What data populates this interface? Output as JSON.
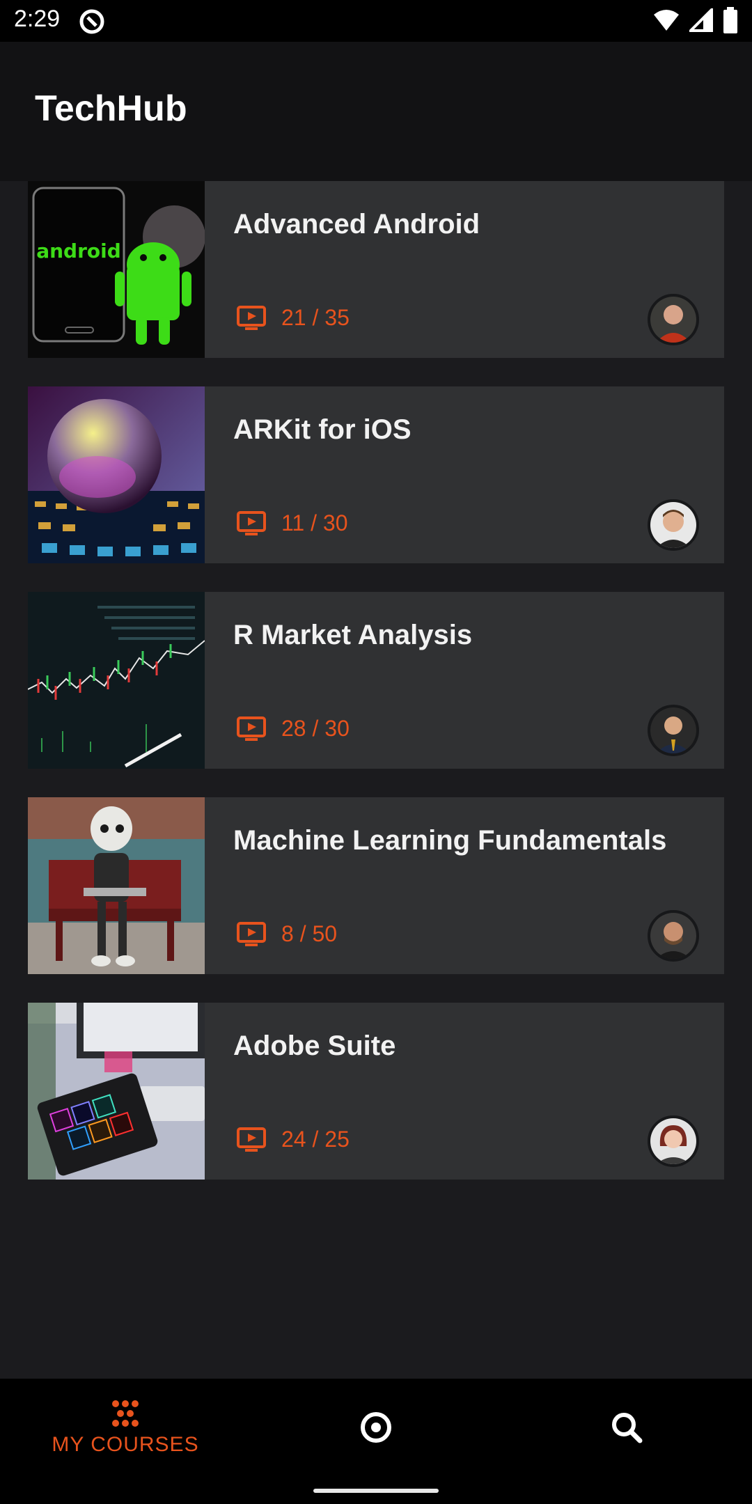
{
  "status_bar": {
    "time": "2:29",
    "icons": [
      "app-notification-icon",
      "wifi-icon",
      "signal-icon",
      "battery-icon"
    ]
  },
  "app_bar": {
    "title": "TechHub"
  },
  "colors": {
    "accent": "#e8531d",
    "card": "#303133",
    "background": "#1b1b1e"
  },
  "courses": [
    {
      "title": "Advanced Android",
      "progress": "21 / 35",
      "thumbnail": "android-robot-photo",
      "instructor_avatar": "instructor-avatar"
    },
    {
      "title": "ARKit for iOS",
      "progress": "11 / 30",
      "thumbnail": "glass-sphere-photo",
      "instructor_avatar": "instructor-avatar"
    },
    {
      "title": "R Market Analysis",
      "progress": "28 / 30",
      "thumbnail": "stock-chart-photo",
      "instructor_avatar": "instructor-avatar"
    },
    {
      "title": "Machine Learning Fundamentals",
      "progress": "8 / 50",
      "thumbnail": "robot-on-bench-photo",
      "instructor_avatar": "instructor-avatar"
    },
    {
      "title": "Adobe Suite",
      "progress": "24 / 25",
      "thumbnail": "adobe-apps-tablet-photo",
      "instructor_avatar": "instructor-avatar"
    }
  ],
  "bottom_nav": {
    "items": [
      {
        "label": "MY COURSES",
        "icon": "dots-grid-icon",
        "active": true
      },
      {
        "label": "",
        "icon": "target-icon",
        "active": false
      },
      {
        "label": "",
        "icon": "search-icon",
        "active": false
      }
    ]
  }
}
